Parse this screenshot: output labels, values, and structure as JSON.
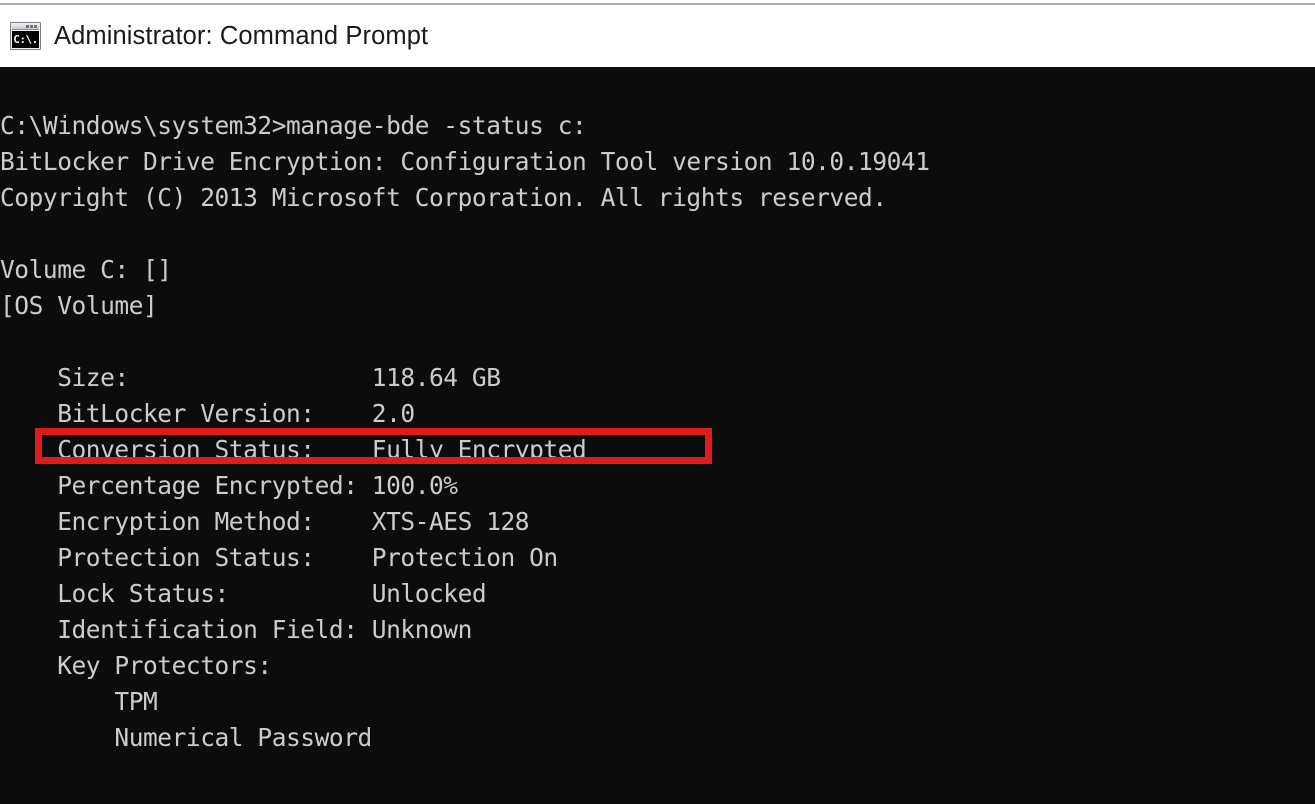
{
  "window": {
    "title": "Administrator: Command Prompt",
    "icon": "command-prompt-icon",
    "icon_glyph": "C:\\.",
    "background_color": "#0c0c0c",
    "text_color": "#cccccc"
  },
  "annotation": {
    "type": "rectangle-highlight",
    "color": "#e01b1b",
    "targets_line": "Conversion Status:    Fully Encrypted"
  },
  "console": {
    "prompt_path": "C:\\Windows\\system32>",
    "command": "manage-bde -status c:",
    "banner": [
      "BitLocker Drive Encryption: Configuration Tool version 10.0.19041",
      "Copyright (C) 2013 Microsoft Corporation. All rights reserved."
    ],
    "volume_header": "Volume C: []",
    "volume_type": "[OS Volume]",
    "fields": [
      {
        "label": "Size:",
        "value": "118.64 GB"
      },
      {
        "label": "BitLocker Version:",
        "value": "2.0"
      },
      {
        "label": "Conversion Status:",
        "value": "Fully Encrypted"
      },
      {
        "label": "Percentage Encrypted:",
        "value": "100.0%"
      },
      {
        "label": "Encryption Method:",
        "value": "XTS-AES 128"
      },
      {
        "label": "Protection Status:",
        "value": "Protection On"
      },
      {
        "label": "Lock Status:",
        "value": "Unlocked"
      },
      {
        "label": "Identification Field:",
        "value": "Unknown"
      },
      {
        "label": "Key Protectors:",
        "value": ""
      }
    ],
    "key_protectors": [
      "TPM",
      "Numerical Password"
    ],
    "full_text": "C:\\Windows\\system32>manage-bde -status c:\nBitLocker Drive Encryption: Configuration Tool version 10.0.19041\nCopyright (C) 2013 Microsoft Corporation. All rights reserved.\n\nVolume C: []\n[OS Volume]\n\n    Size:                 118.64 GB\n    BitLocker Version:    2.0\n    Conversion Status:    Fully Encrypted\n    Percentage Encrypted: 100.0%\n    Encryption Method:    XTS-AES 128\n    Protection Status:    Protection On\n    Lock Status:          Unlocked\n    Identification Field: Unknown\n    Key Protectors:\n        TPM\n        Numerical Password"
  }
}
